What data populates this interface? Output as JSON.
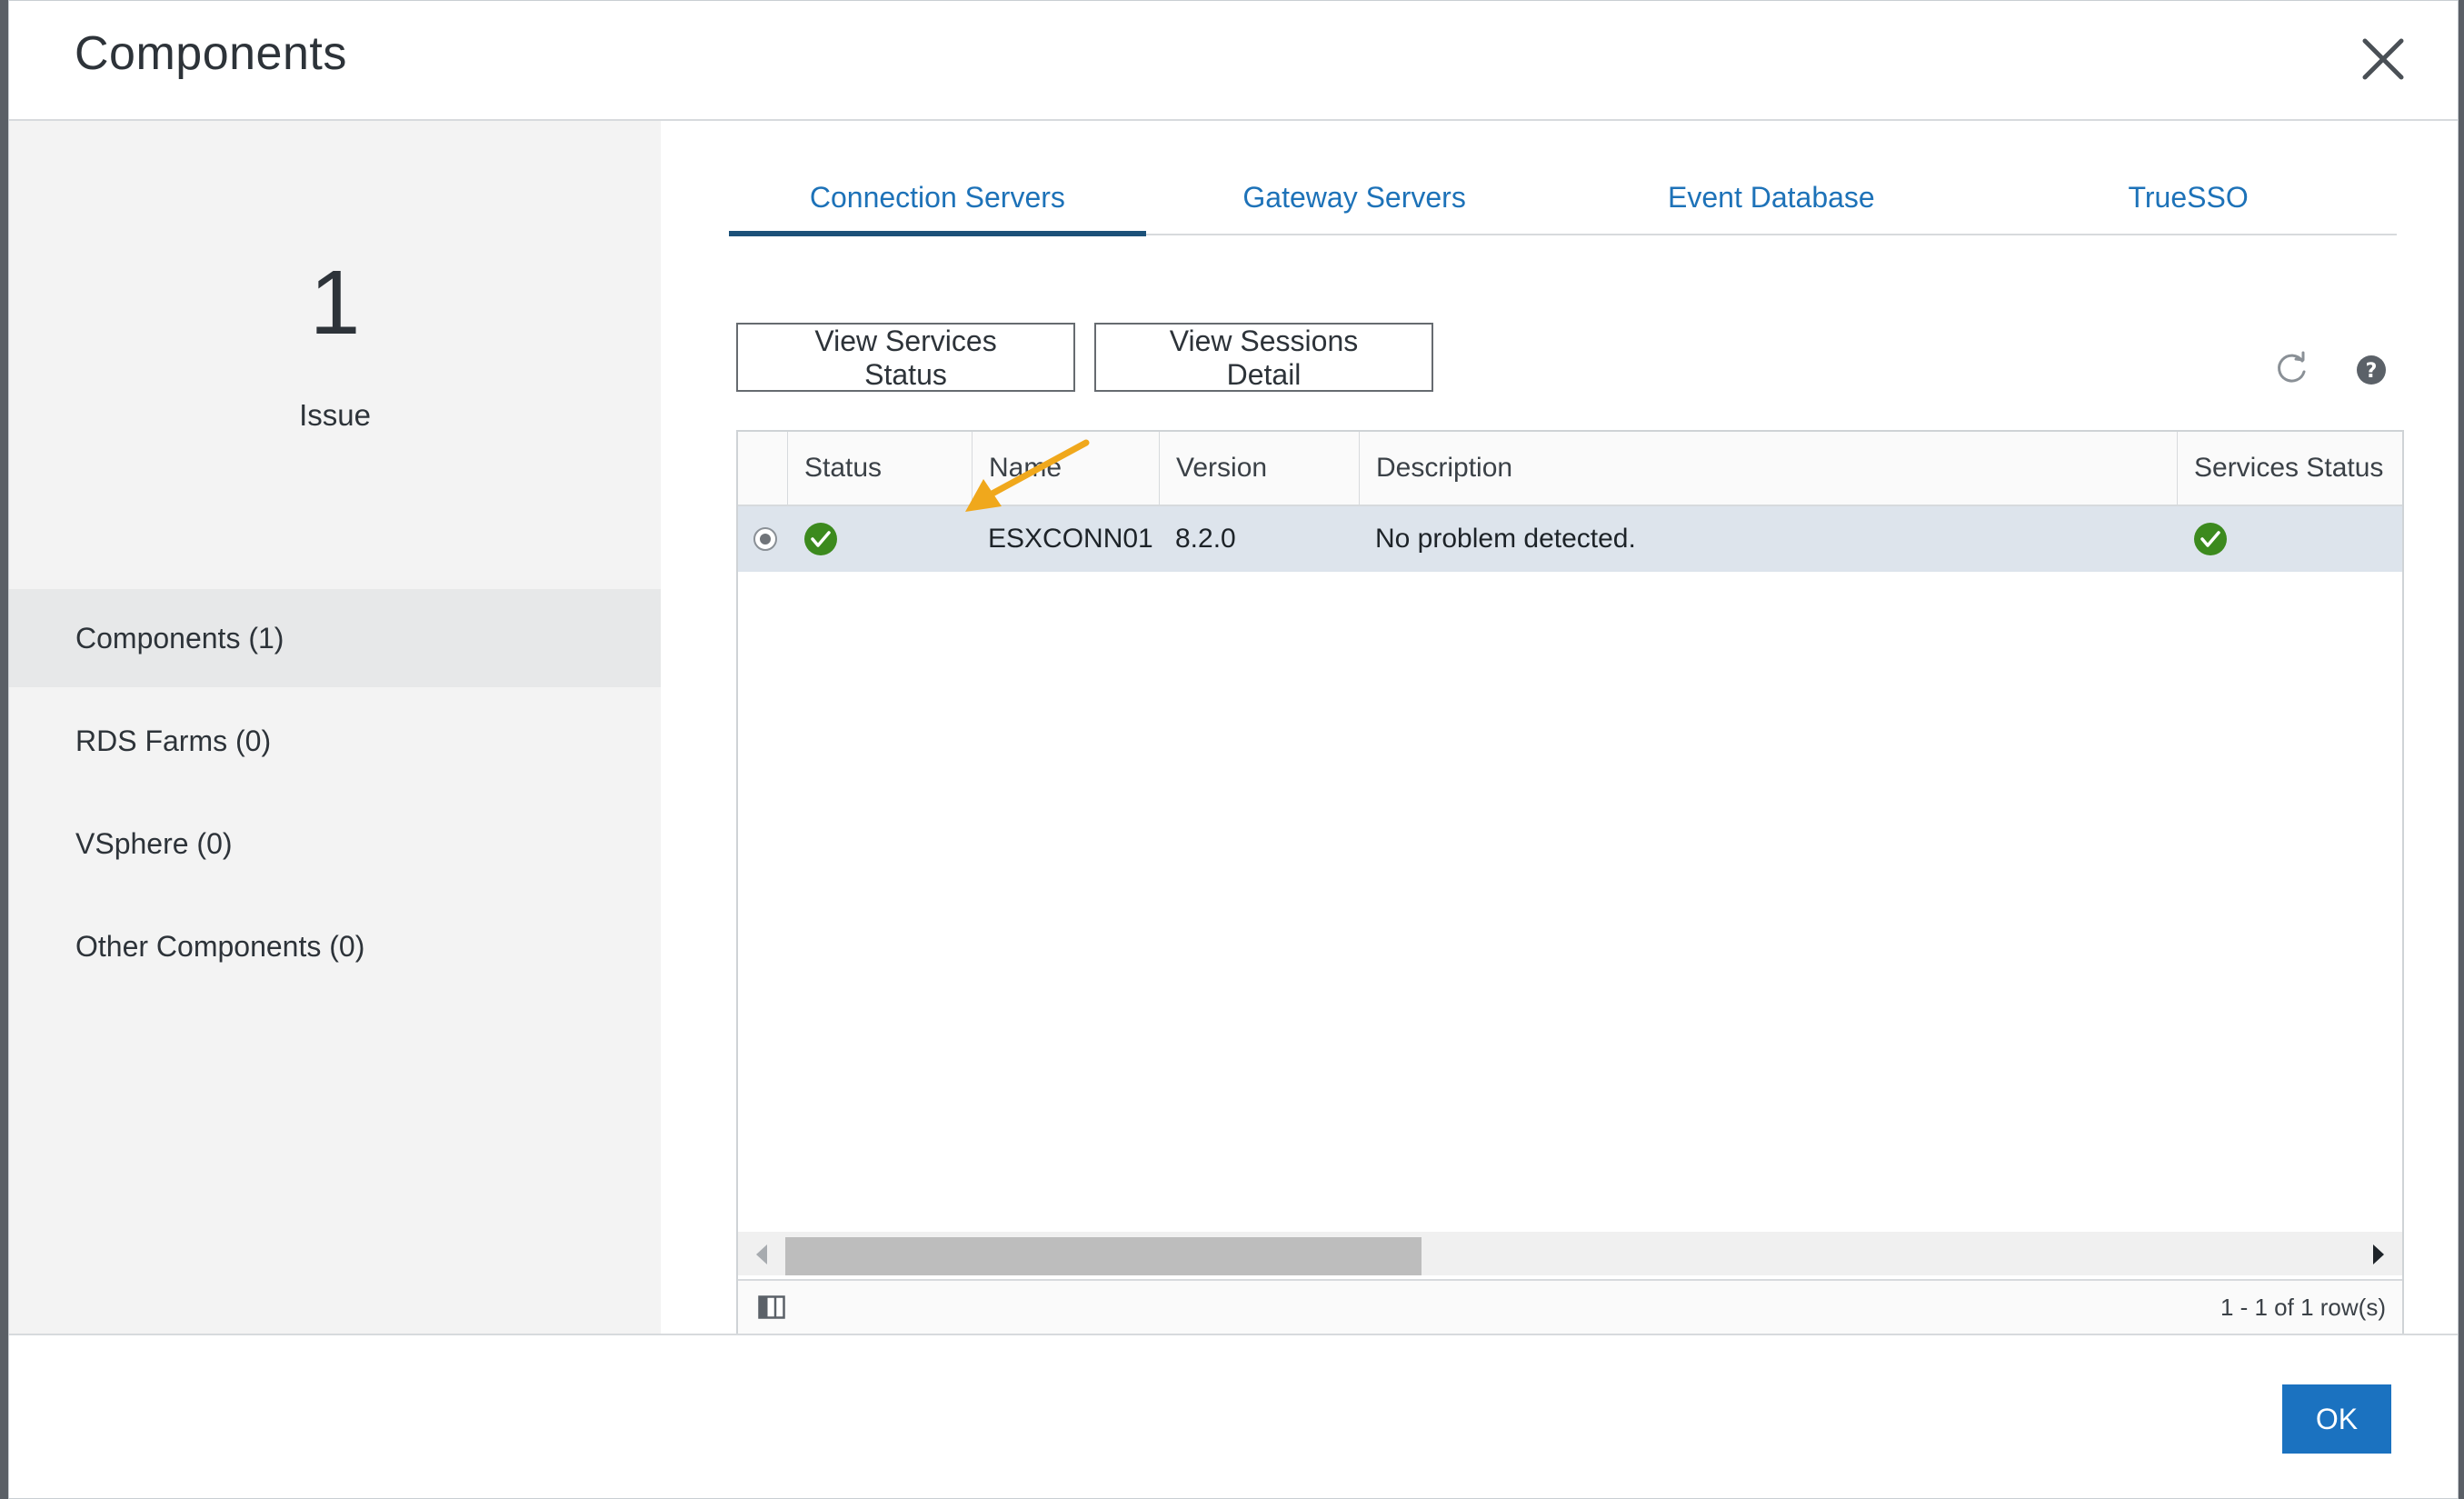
{
  "dialog": {
    "title": "Components",
    "close_icon": "close-icon"
  },
  "summary": {
    "issue_count": "1",
    "issue_label": "Issue"
  },
  "nav": {
    "items": [
      {
        "label": "Components (1)",
        "active": true
      },
      {
        "label": "RDS Farms (0)",
        "active": false
      },
      {
        "label": "VSphere (0)",
        "active": false
      },
      {
        "label": "Other Components (0)",
        "active": false
      }
    ]
  },
  "tabs": [
    {
      "label": "Connection Servers",
      "active": true
    },
    {
      "label": "Gateway Servers",
      "active": false
    },
    {
      "label": "Event Database",
      "active": false
    },
    {
      "label": "TrueSSO",
      "active": false
    }
  ],
  "toolbar": {
    "view_services_label": "View Services Status",
    "view_sessions_label": "View Sessions Detail",
    "refresh_icon": "refresh-icon",
    "help_icon": "help-icon"
  },
  "grid": {
    "columns": [
      "Status",
      "Name",
      "Version",
      "Description",
      "Services Status"
    ],
    "rows": [
      {
        "status_icon": "check-circle-icon",
        "name": "ESXCONN01",
        "version": "8.2.0",
        "description": "No problem detected.",
        "services_status_icon": "check-circle-icon"
      }
    ],
    "footer_count": "1 - 1 of 1 row(s)"
  },
  "footer": {
    "ok_label": "OK"
  },
  "colors": {
    "accent": "#1d72b8",
    "ok_button": "#1b72c0",
    "status_ok": "#3c8a1e",
    "annotation_arrow": "#f0a81c",
    "selected_row": "#dde4ec"
  }
}
